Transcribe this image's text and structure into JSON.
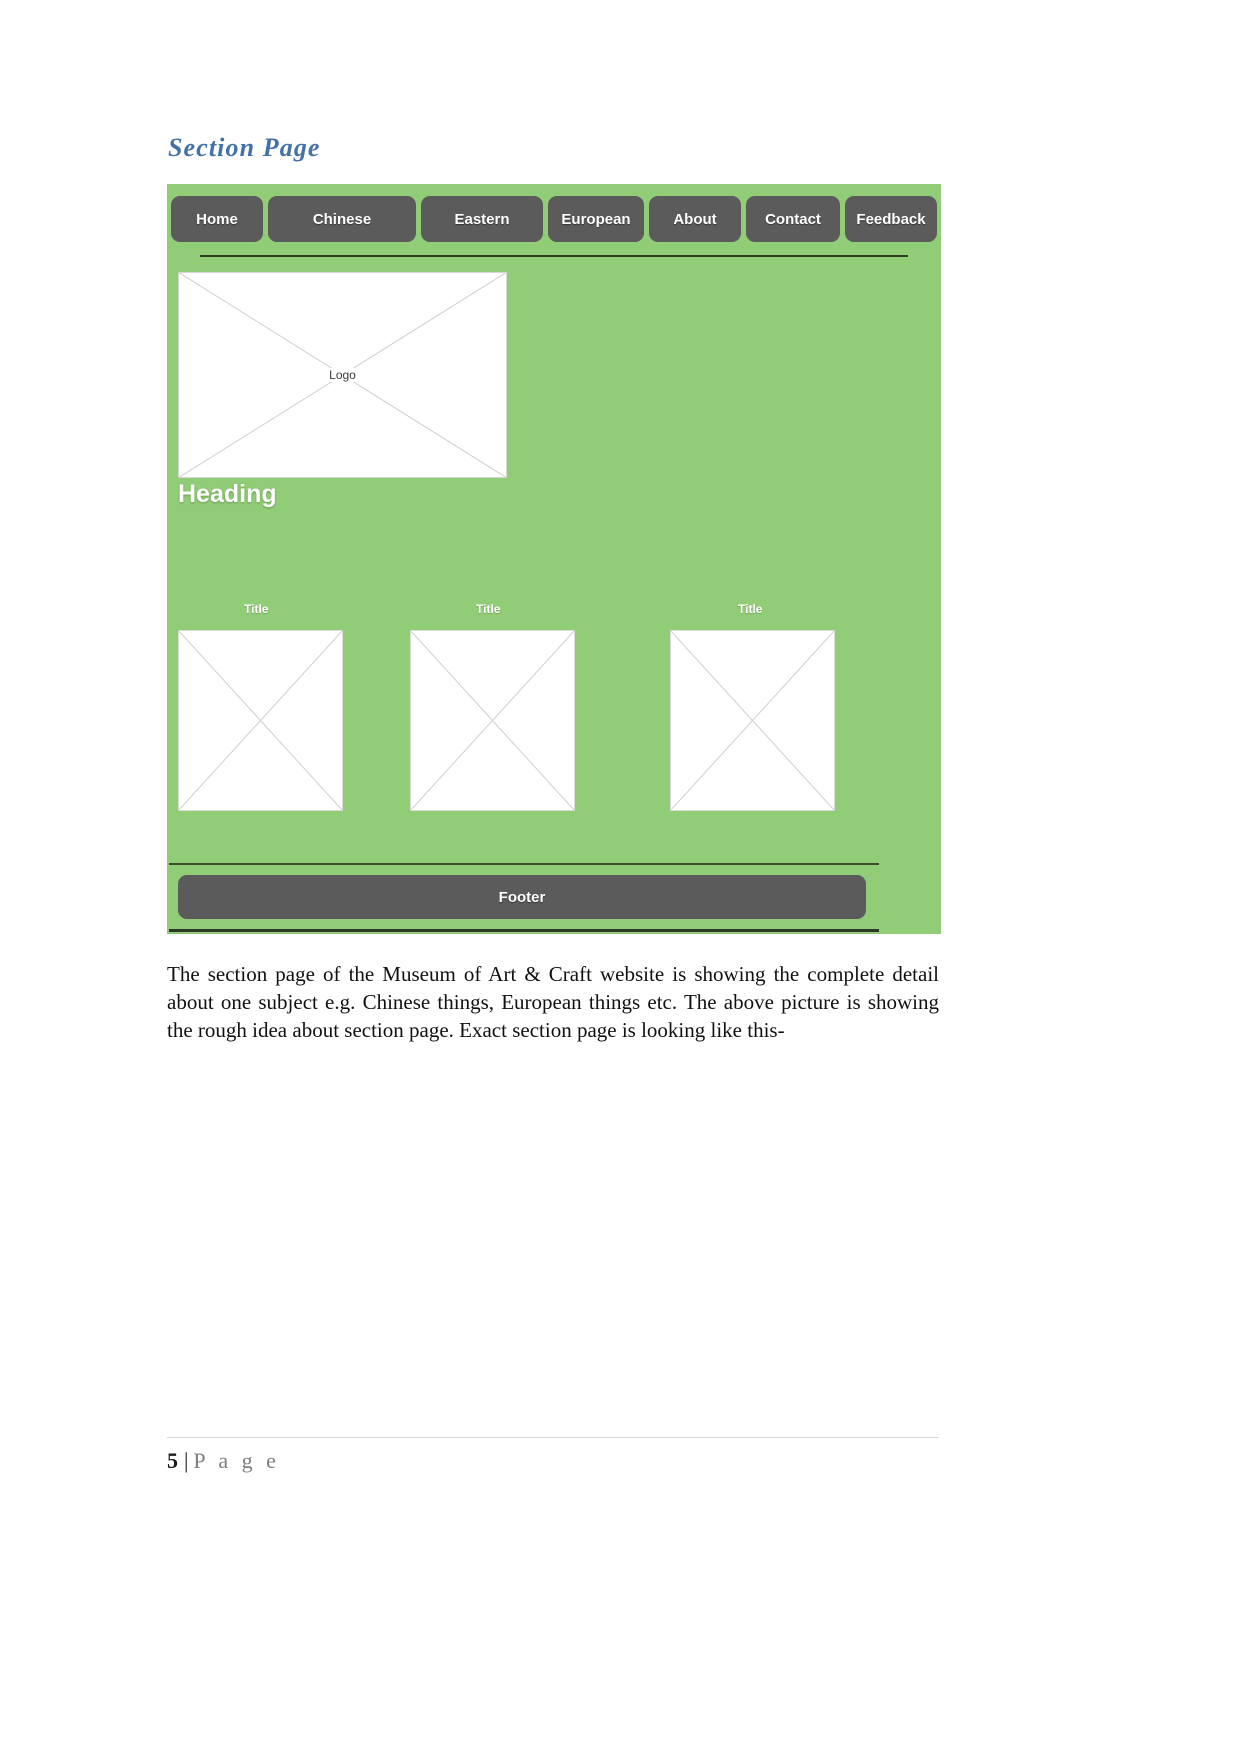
{
  "document": {
    "section_heading": "Section Page",
    "body_paragraph": "The section page of the Museum of Art & Craft website is showing the complete detail about one subject e.g. Chinese things, European things etc. The above picture is showing the rough idea about section page. Exact section page is looking like this-",
    "page_footer": {
      "number": "5",
      "separator": "|",
      "word": "P a g e"
    }
  },
  "mockup": {
    "background_color": "#91cc76",
    "button_color": "#5b5b5b",
    "nav": [
      {
        "label": "Home"
      },
      {
        "label": "Chinese"
      },
      {
        "label": "Eastern"
      },
      {
        "label": "European"
      },
      {
        "label": "About"
      },
      {
        "label": "Contact"
      },
      {
        "label": "Feedback"
      }
    ],
    "logo_placeholder": {
      "label": "Logo"
    },
    "heading": "Heading",
    "cards": [
      {
        "title": "Title"
      },
      {
        "title": "Title"
      },
      {
        "title": "Title"
      }
    ],
    "footer": {
      "label": "Footer"
    }
  }
}
